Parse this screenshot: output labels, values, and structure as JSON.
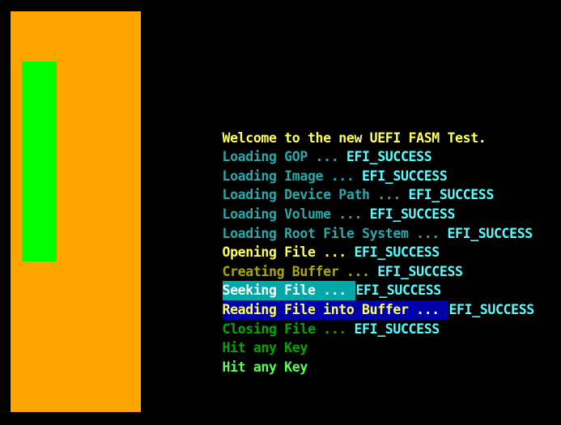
{
  "colors": {
    "background": "#000000",
    "orange_panel": "#ffa500",
    "green_bar": "#00ff00",
    "yellow": "#ffff55",
    "cyan_bright": "#55ffff",
    "teal": "#2aa8a8",
    "dark_yellow": "#aaa800",
    "dark_green": "#00a800",
    "bright_green": "#55ff55",
    "white": "#ffffff",
    "hl_teal_bg": "#00a8a8",
    "hl_blue_bg": "#0000aa"
  },
  "console": {
    "lines": [
      {
        "prefix": "Welcome to the new UEFI FASM Test.",
        "status": ""
      },
      {
        "prefix": "Loading GOP ... ",
        "status": "EFI_SUCCESS"
      },
      {
        "prefix": "Loading Image ... ",
        "status": "EFI_SUCCESS"
      },
      {
        "prefix": "Loading Device Path ... ",
        "status": "EFI_SUCCESS"
      },
      {
        "prefix": "Loading Volume ... ",
        "status": "EFI_SUCCESS"
      },
      {
        "prefix": "Loading Root File System ... ",
        "status": "EFI_SUCCESS"
      },
      {
        "prefix": "Opening File ... ",
        "status": "EFI_SUCCESS"
      },
      {
        "prefix": "Creating Buffer ... ",
        "status": "EFI_SUCCESS"
      },
      {
        "prefix": "Seeking File ... ",
        "status": "EFI_SUCCESS"
      },
      {
        "prefix": "Reading File into Buffer ... ",
        "status": "EFI_SUCCESS"
      },
      {
        "prefix": "Closing File ... ",
        "status": "EFI_SUCCESS"
      },
      {
        "prefix": "Hit any Key",
        "status": ""
      },
      {
        "prefix": "Hit any Key",
        "status": ""
      }
    ]
  }
}
